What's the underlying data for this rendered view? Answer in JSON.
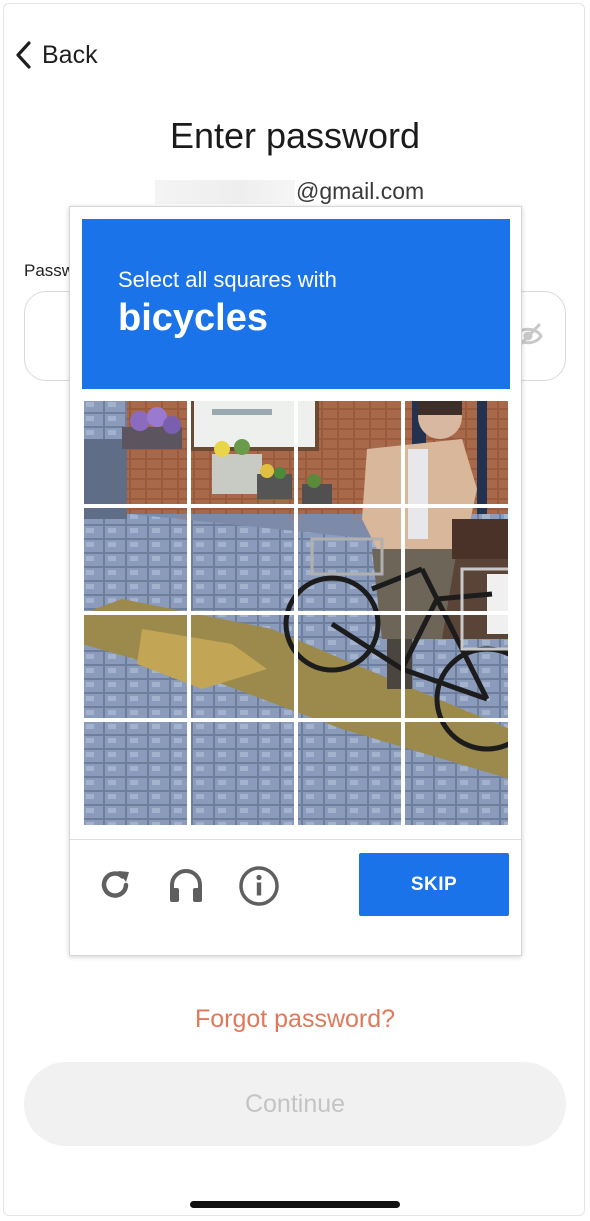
{
  "nav": {
    "back_label": "Back"
  },
  "page": {
    "title": "Enter password",
    "email_suffix": "@gmail.com",
    "password_label": "Password",
    "forgot_password": "Forgot password?",
    "continue_label": "Continue"
  },
  "captcha": {
    "prompt": "Select all squares with",
    "object": "bicycles",
    "grid_size": 4,
    "skip_label": "SKIP",
    "colors": {
      "header": "#1a73e8",
      "skip_button": "#1a73e8"
    }
  },
  "colors": {
    "forgot_link": "#e0785a",
    "continue_disabled_text": "#c4c4c4"
  },
  "icons": {
    "back": "chevron-left-icon",
    "eye": "eye-off-icon",
    "reload": "reload-icon",
    "audio": "headphones-icon",
    "info": "info-icon"
  }
}
